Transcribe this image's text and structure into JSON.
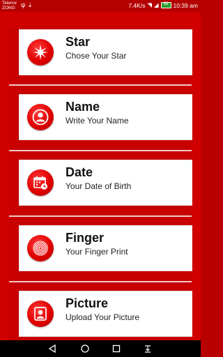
{
  "status": {
    "carrier_line1": "Telenor",
    "carrier_line2": "ZONG",
    "speed": "7.4K/s",
    "battery": "68",
    "time": "10:39 am"
  },
  "items": [
    {
      "title": "Star",
      "subtitle": "Chose Your Star",
      "icon": "star-burst-icon"
    },
    {
      "title": "Name",
      "subtitle": "Write Your Name",
      "icon": "person-icon"
    },
    {
      "title": "Date",
      "subtitle": "Your Date of Birth",
      "icon": "calendar-icon"
    },
    {
      "title": "Finger",
      "subtitle": "Your Finger Print",
      "icon": "fingerprint-icon"
    },
    {
      "title": "Picture",
      "subtitle": "Upload Your Picture",
      "icon": "person-portrait-icon"
    }
  ],
  "nav": [
    "back-icon",
    "home-icon",
    "recents-icon",
    "notifications-icon"
  ]
}
